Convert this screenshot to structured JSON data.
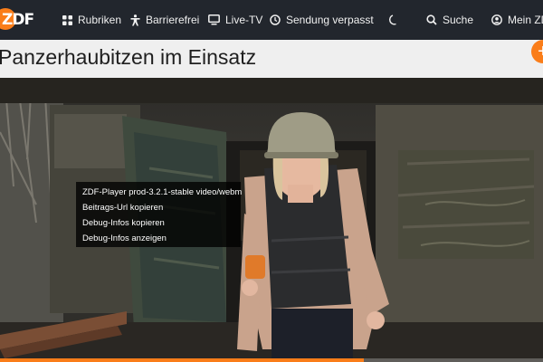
{
  "header": {
    "logo_text": "ZDF",
    "nav": [
      {
        "label": "Rubriken",
        "icon": "grid-icon"
      },
      {
        "label": "Barrierefrei",
        "icon": "accessibility-icon"
      },
      {
        "label": "Live-TV",
        "icon": "tv-icon"
      },
      {
        "label": "Sendung verpasst",
        "icon": "clock-icon"
      },
      {
        "label": "",
        "icon": "moon-icon"
      },
      {
        "label": "Suche",
        "icon": "search-icon"
      },
      {
        "label": "Mein ZDF",
        "icon": "user-icon"
      }
    ],
    "accent_color": "#fa7d19",
    "background_color": "#22262d"
  },
  "page": {
    "title": "Panzerhaubitzen im Einsatz",
    "plus_label": "+"
  },
  "player": {
    "context_menu": [
      "ZDF-Player prod-3.2.1-stable video/webm",
      "Beitrags-Url kopieren",
      "Debug-Infos kopieren",
      "Debug-Infos anzeigen"
    ],
    "progress_fraction": 0.67
  }
}
